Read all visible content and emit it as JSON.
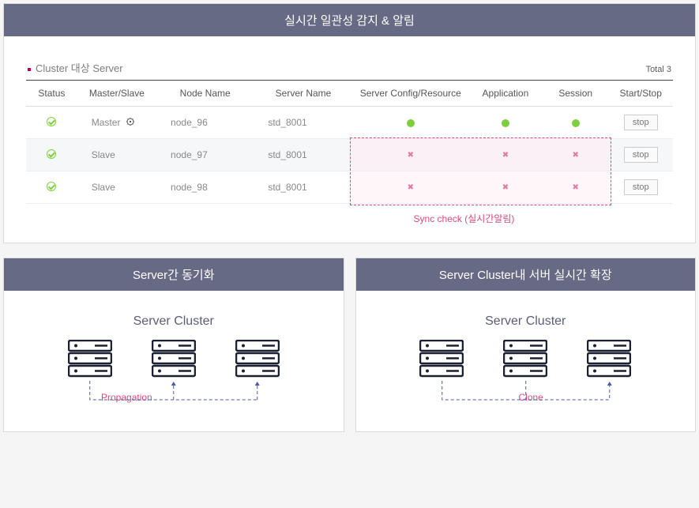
{
  "top": {
    "title": "실시간 일관성 감지 & 알림",
    "section_title": "Cluster 대상 Server",
    "total_label": "Total",
    "total_value": "3",
    "sync_label": "Sync check (실시간알림)",
    "columns": {
      "status": "Status",
      "role": "Master/Slave",
      "node": "Node Name",
      "server": "Server Name",
      "cfg": "Server Config/Resource",
      "app": "Application",
      "sess": "Session",
      "ctrl": "Start/Stop"
    },
    "rows": [
      {
        "role": "Master",
        "gear": true,
        "node": "node_96",
        "server": "std_8001",
        "cfg": "ok",
        "app": "ok",
        "sess": "ok",
        "btn": "stop"
      },
      {
        "role": "Slave",
        "gear": false,
        "node": "node_97",
        "server": "std_8001",
        "cfg": "err",
        "app": "err",
        "sess": "err",
        "btn": "stop"
      },
      {
        "role": "Slave",
        "gear": false,
        "node": "node_98",
        "server": "std_8001",
        "cfg": "err",
        "app": "err",
        "sess": "err",
        "btn": "stop"
      }
    ]
  },
  "bottom_left": {
    "title": "Server간 동기화",
    "cluster_title": "Server Cluster",
    "label": "Propagation"
  },
  "bottom_right": {
    "title": "Server Cluster내 서버 실시간 확장",
    "cluster_title": "Server Cluster",
    "label": "Clone"
  }
}
